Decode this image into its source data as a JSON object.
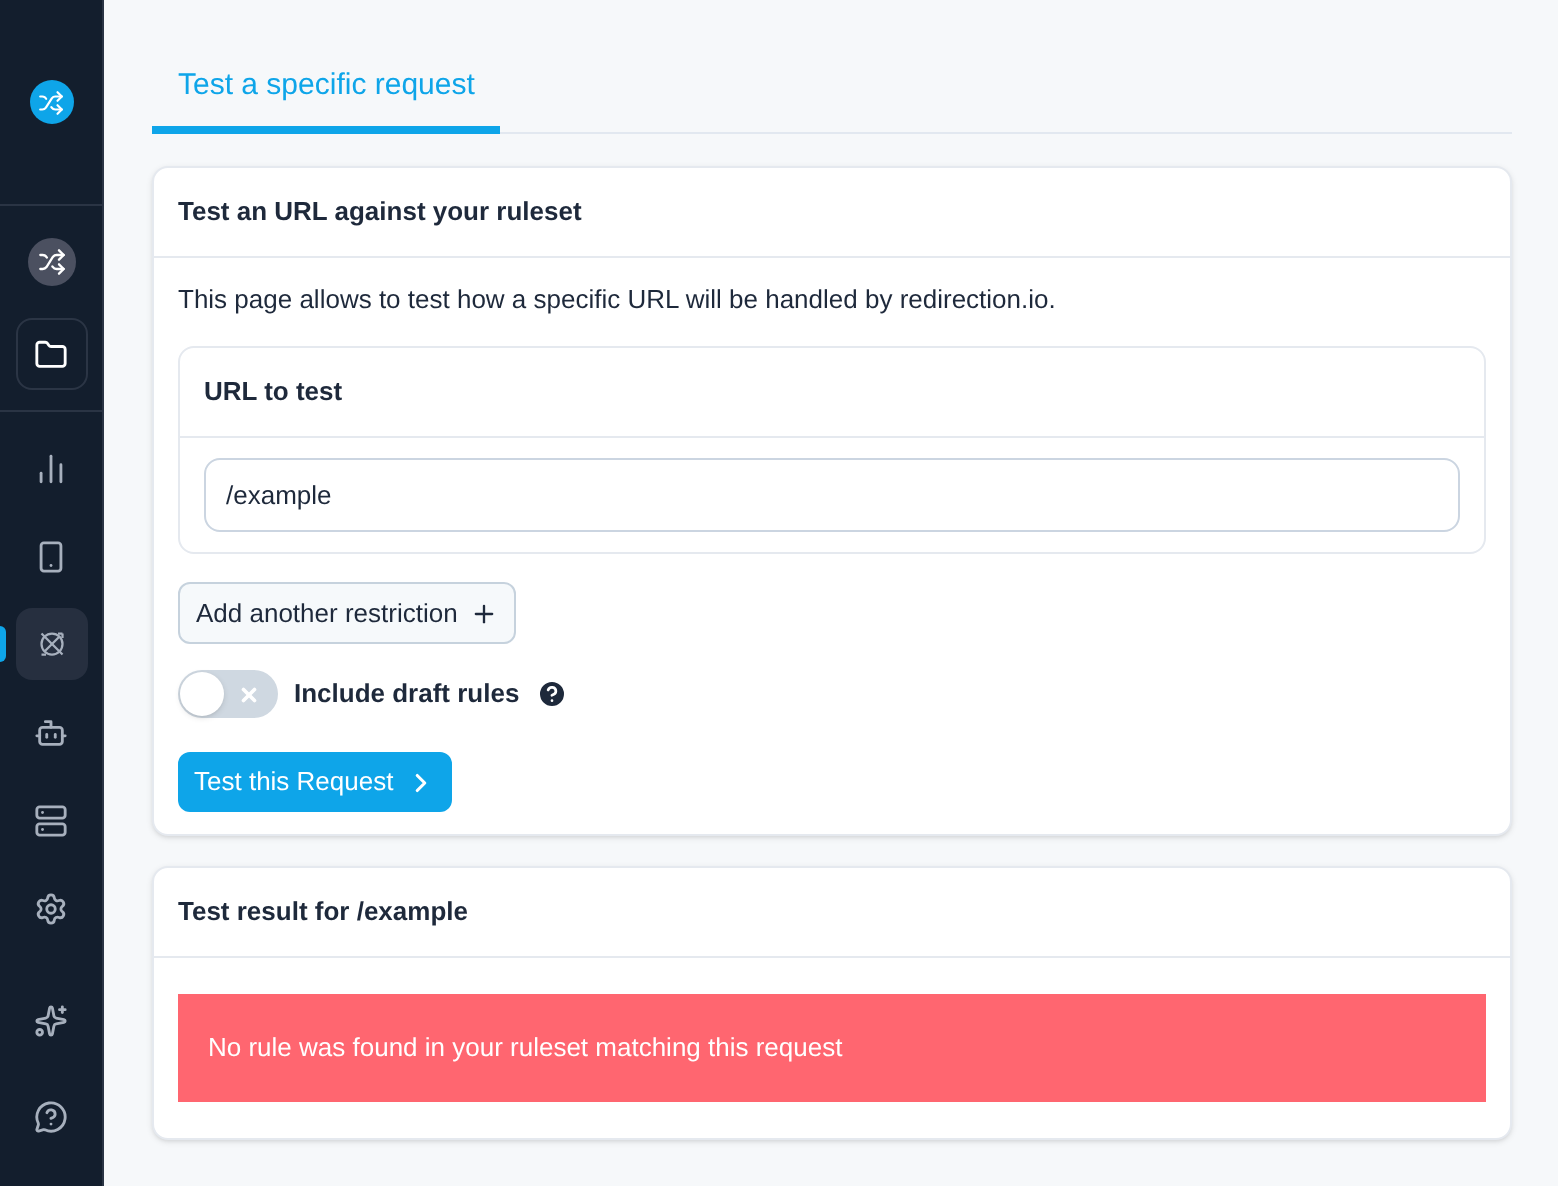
{
  "sidebar": {
    "top_items": [
      {
        "selected": false
      },
      {
        "selected": false
      }
    ],
    "items": [
      {
        "selected": false
      },
      {
        "selected": false
      },
      {
        "selected": true
      },
      {
        "selected": false
      },
      {
        "selected": false
      },
      {
        "selected": false
      }
    ],
    "bottom_items": [
      {
        "selected": false
      },
      {
        "selected": false
      }
    ]
  },
  "tabs": [
    {
      "label": "Test a specific request",
      "selected": true
    }
  ],
  "test_card": {
    "title": "Test an URL against your ruleset",
    "description": "This page allows to test how a specific URL will be handled by redirection.io.",
    "url_panel": {
      "title": "URL to test",
      "value": "/example"
    },
    "add_button": "Add another restriction",
    "draft_toggle": {
      "label": "Include draft rules",
      "on": false
    },
    "submit_button": "Test this Request"
  },
  "result_card": {
    "title": "Test result for /example",
    "message": "No rule was found in your ruleset matching this request"
  }
}
